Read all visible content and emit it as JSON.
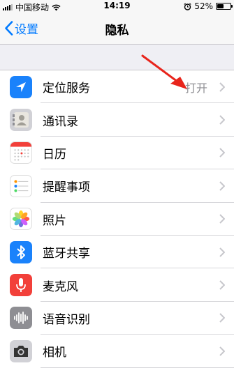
{
  "status_bar": {
    "carrier": "中国移动",
    "time": "14:19",
    "battery_percent": "52%",
    "battery_level": 0.52
  },
  "nav": {
    "back_label": "设置",
    "title": "隐私"
  },
  "rows": [
    {
      "label": "定位服务",
      "value": "打开",
      "icon": "location-icon",
      "color": "#1a82fb"
    },
    {
      "label": "通讯录",
      "value": "",
      "icon": "contacts-icon",
      "color": "#d1d1d6"
    },
    {
      "label": "日历",
      "value": "",
      "icon": "calendar-icon",
      "color": "#ffffff"
    },
    {
      "label": "提醒事项",
      "value": "",
      "icon": "reminders-icon",
      "color": "#ffffff"
    },
    {
      "label": "照片",
      "value": "",
      "icon": "photos-icon",
      "color": "#ffffff"
    },
    {
      "label": "蓝牙共享",
      "value": "",
      "icon": "bluetooth-icon",
      "color": "#1a82fb"
    },
    {
      "label": "麦克风",
      "value": "",
      "icon": "microphone-icon",
      "color": "#f2403a"
    },
    {
      "label": "语音识别",
      "value": "",
      "icon": "speech-recognition-icon",
      "color": "#8e8e93"
    },
    {
      "label": "相机",
      "value": "",
      "icon": "camera-icon",
      "color": "#d1d1d6"
    }
  ]
}
